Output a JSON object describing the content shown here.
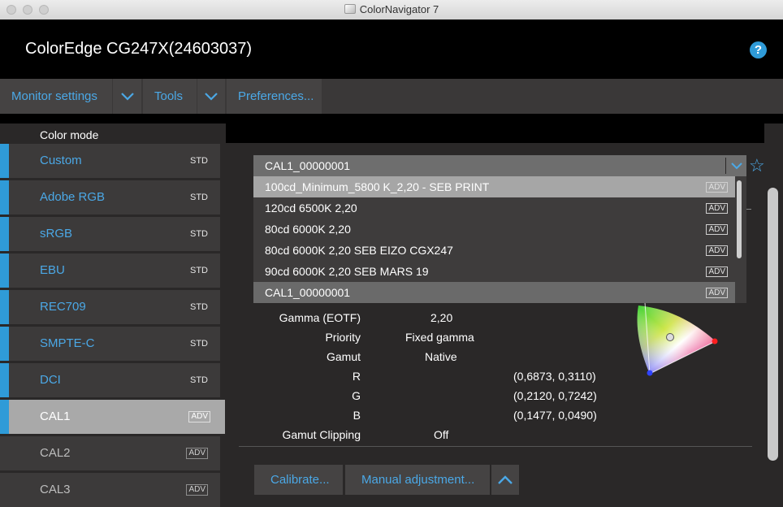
{
  "window": {
    "title": "ColorNavigator 7"
  },
  "header": {
    "device": "ColorEdge CG247X(24603037)",
    "help": "?"
  },
  "menu": {
    "monitor_settings": "Monitor settings",
    "tools": "Tools",
    "preferences": "Preferences..."
  },
  "sidebar": {
    "heading": "Color mode",
    "modes": [
      {
        "label": "Custom",
        "tag": "STD"
      },
      {
        "label": "Adobe RGB",
        "tag": "STD"
      },
      {
        "label": "sRGB",
        "tag": "STD"
      },
      {
        "label": "EBU",
        "tag": "STD"
      },
      {
        "label": "REC709",
        "tag": "STD"
      },
      {
        "label": "SMPTE-C",
        "tag": "STD"
      },
      {
        "label": "DCI",
        "tag": "STD"
      },
      {
        "label": "CAL1",
        "tag": "ADV"
      },
      {
        "label": "CAL2",
        "tag": "ADV"
      },
      {
        "label": "CAL3",
        "tag": "ADV"
      }
    ]
  },
  "target": {
    "selected": "CAL1_00000001",
    "options": [
      {
        "label": "100cd_Minimum_5800 K_2,20 - SEB PRINT",
        "tag": "ADV"
      },
      {
        "label": "120cd 6500K 2,20",
        "tag": "ADV"
      },
      {
        "label": "80cd 6000K 2,20",
        "tag": "ADV"
      },
      {
        "label": "80cd 6000K 2,20 SEB EIZO CGX247",
        "tag": "ADV"
      },
      {
        "label": "90cd 6000K 2,20 SEB MARS 19",
        "tag": "ADV"
      },
      {
        "label": "CAL1_00000001",
        "tag": "ADV"
      }
    ]
  },
  "details": {
    "gamma_label": "Gamma (EOTF)",
    "gamma_value": "2,20",
    "priority_label": "Priority",
    "priority_value": "Fixed gamma",
    "gamut_label": "Gamut",
    "gamut_value": "Native",
    "r_label": "R",
    "r_value": "(0,6873, 0,3110)",
    "g_label": "G",
    "g_value": "(0,2120, 0,7242)",
    "b_label": "B",
    "b_value": "(0,1477, 0,0490)",
    "clipping_label": "Gamut Clipping",
    "clipping_value": "Off"
  },
  "actions": {
    "calibrate": "Calibrate...",
    "manual": "Manual adjustment..."
  },
  "colors": {
    "accent": "#4ba8e6",
    "selection_bar": "#2f9bd8"
  }
}
